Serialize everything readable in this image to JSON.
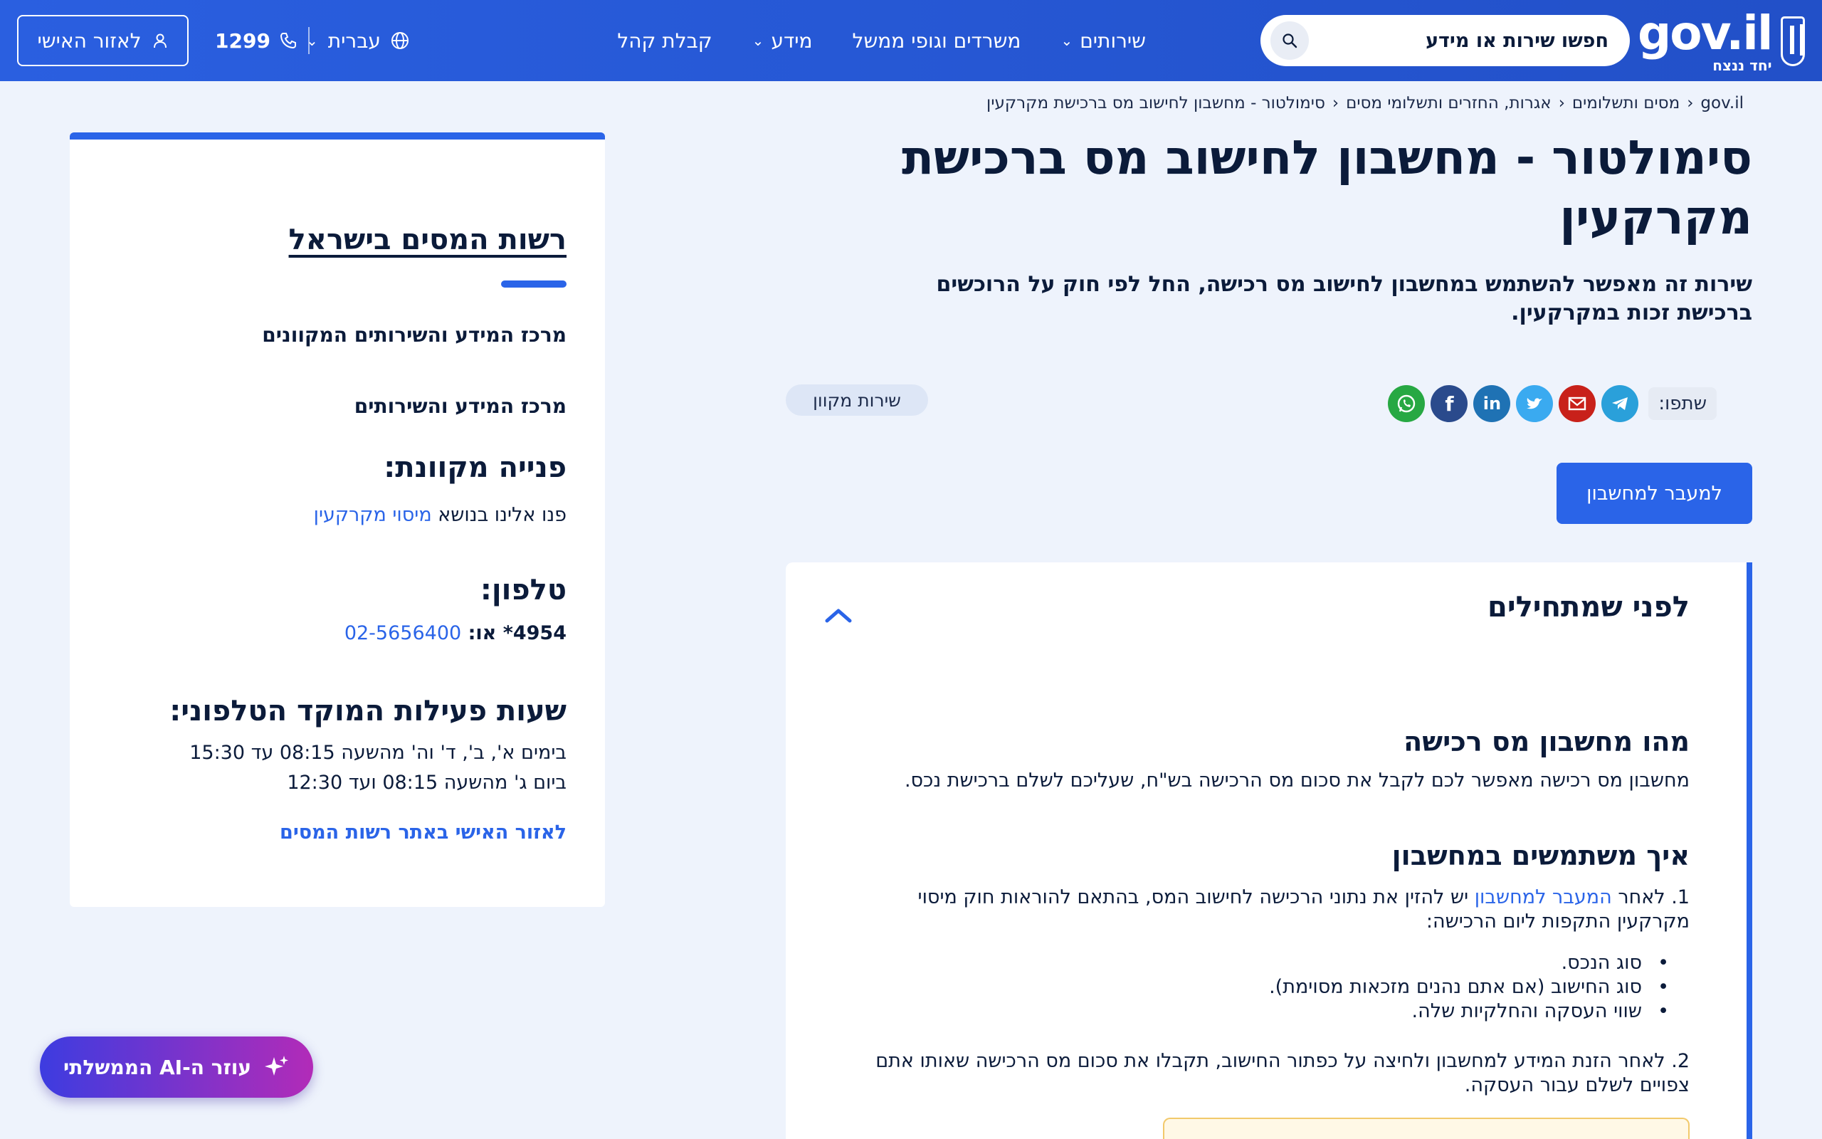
{
  "header": {
    "logo": {
      "brand": "gov.il",
      "tagline": "יחד ננצח"
    },
    "search": {
      "placeholder": "חפשו שירות או מידע"
    },
    "nav": [
      {
        "label": "שירותים",
        "has_dropdown": true
      },
      {
        "label": "משרדים וגופי ממשל",
        "has_dropdown": false
      },
      {
        "label": "מידע",
        "has_dropdown": true
      },
      {
        "label": "קבלת קהל",
        "has_dropdown": false
      }
    ],
    "language": "עברית",
    "phone": "1299",
    "personal_area": "לאזור האישי"
  },
  "breadcrumb": [
    "gov.il",
    "מסים ותשלומים",
    "אגרות, החזרים ותשלומי מסים",
    "סימולטור - מחשבון לחישוב מס ברכישת מקרקעין"
  ],
  "page": {
    "title": "סימולטור - מחשבון לחישוב מס ברכישת מקרקעין",
    "intro": "שירות זה מאפשר להשתמש במחשבון לחישוב מס רכישה, החל לפי חוק על הרוכשים ברכישת זכות במקרקעין.",
    "share_label": "שתפו:",
    "badge": "שירות מקוון",
    "calc_button": "למעבר למחשבון"
  },
  "accordion": {
    "title": "לפני שמתחילים",
    "h_what": "מהו מחשבון מס רכישה",
    "p_what": "מחשבון מס רכישה מאפשר לכם לקבל את סכום מס הרכישה בש\"ח, שעליכם לשלם ברכישת נכס.",
    "h_how": "איך משתמשים במחשבון",
    "step1_prefix": "1. לאחר ",
    "step1_link": "המעבר למחשבון",
    "step1_suffix": " יש להזין את נתוני הרכישה לחישוב המס, בהתאם להוראות חוק מיסוי מקרקעין התקפות ליום הרכישה:",
    "bullets": [
      "סוג הנכס.",
      "סוג החישוב (אם אתם נהנים מזכאות מסוימת).",
      "שווי העסקה והחלקיות שלה."
    ],
    "step2": "2. לאחר הזנת המידע למחשבון ולחיצה על כפתור החישוב, תקבלו את סכום מס הרכישה שאותו אתם צפויים לשלם עבור העסקה."
  },
  "sidebar": {
    "org": "רשות המסים בישראל",
    "sub1": "מרכז המידע והשירותים המקוונים",
    "sub2": "מרכז המידע והשירותים",
    "online_h": "פנייה מקוונת:",
    "online_prefix": "פנו אלינו בנושא ",
    "online_link": "מיסוי מקרקעין",
    "phone_h": "טלפון:",
    "phone_prefix": "4954* או: ",
    "phone_link": "02-5656400",
    "hours_h": "שעות פעילות המוקד הטלפוני:",
    "hours1": "בימים א', ב', ד' וה' מהשעה 08:15 עד 15:30",
    "hours2": "ביום ג' מהשעה 08:15 ועד 12:30",
    "personal_link": "לאזור האישי באתר רשות המסים"
  },
  "ai_button": "עוזר ה-AI הממשלתי",
  "colors": {
    "brand_blue": "#2a64e8",
    "header": "#2a5bd7"
  }
}
